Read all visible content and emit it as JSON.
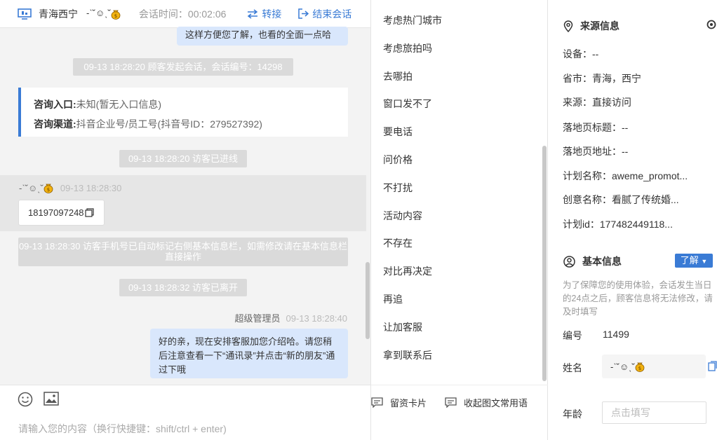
{
  "header": {
    "region": "青海西宁",
    "visitor_name": "-ˋ˘☺ˎ˘",
    "session_time_label": "会话时间：00:02:06",
    "transfer_label": "转接",
    "end_label": "结束会话"
  },
  "messages": {
    "top_bubble": "这样方便您了解，也看的全面一点哈",
    "sys_session_start": "09-13 18:28:20 顾客发起会话，会话编号：14298",
    "entry_label": "咨询入口:",
    "entry_value": "未知(暂无入口信息)",
    "channel_label": "咨询渠道:",
    "channel_value": "抖音企业号/员工号(抖音号ID：279527392)",
    "sys_visitor_in": "09-13 18:28:20 访客已进线",
    "visitor_name": "-ˋ˘☺ˎ˘",
    "visitor_time": "09-13 18:28:30",
    "visitor_phone": "18197097248",
    "sys_phone_marked": "09-13 18:28:30 访客手机号已自动标记右侧基本信息栏，如需修改请在基本信息栏直接操作",
    "sys_visitor_left": "09-13 18:28:32 访客已离开",
    "agent_name": "超级管理员",
    "agent_time": "09-13 18:28:40",
    "agent_message": "好的亲，现在安排客服加您介绍哈。请您稍后注意查看一下“通讯录”并点击“新的朋友”通过下哦"
  },
  "input": {
    "placeholder": "请输入您的内容（换行快捷键：shift/ctrl + enter)"
  },
  "quick_replies": [
    "考虑热门城市",
    "考虑旅拍吗",
    "去哪拍",
    "窗口发不了",
    "要电话",
    "问价格",
    "不打扰",
    "活动内容",
    "不存在",
    "对比再决定",
    "再追",
    "让加客服",
    "拿到联系后"
  ],
  "quick_bottom": {
    "card_label": "留资卡片",
    "collapse_label": "收起图文常用语"
  },
  "source_info": {
    "title": "来源信息",
    "rows": [
      "设备：--",
      "省市：青海，西宁",
      "来源：直接访问",
      "落地页标题：--",
      "落地页地址：--",
      "计划名称：aweme_promot...",
      "创意名称：看腻了传统婚...",
      "计划id：177482449118..."
    ]
  },
  "basic_info": {
    "title": "基本信息",
    "learn_button": "了解",
    "notice": "为了保障您的使用体验，会话发生当日的24点之后，顾客信息将无法修改，请及时填写",
    "number_label": "编号",
    "number_value": "11499",
    "name_label": "姓名",
    "name_value": "-ˋ˘☺ˎ˘",
    "age_label": "年龄",
    "age_placeholder": "点击填写"
  },
  "colors": {
    "accent": "#3a7bd5",
    "bubble_agent": "#d9e7fc",
    "system_msg": "#dadada",
    "chat_bg": "#f3f3f3"
  }
}
